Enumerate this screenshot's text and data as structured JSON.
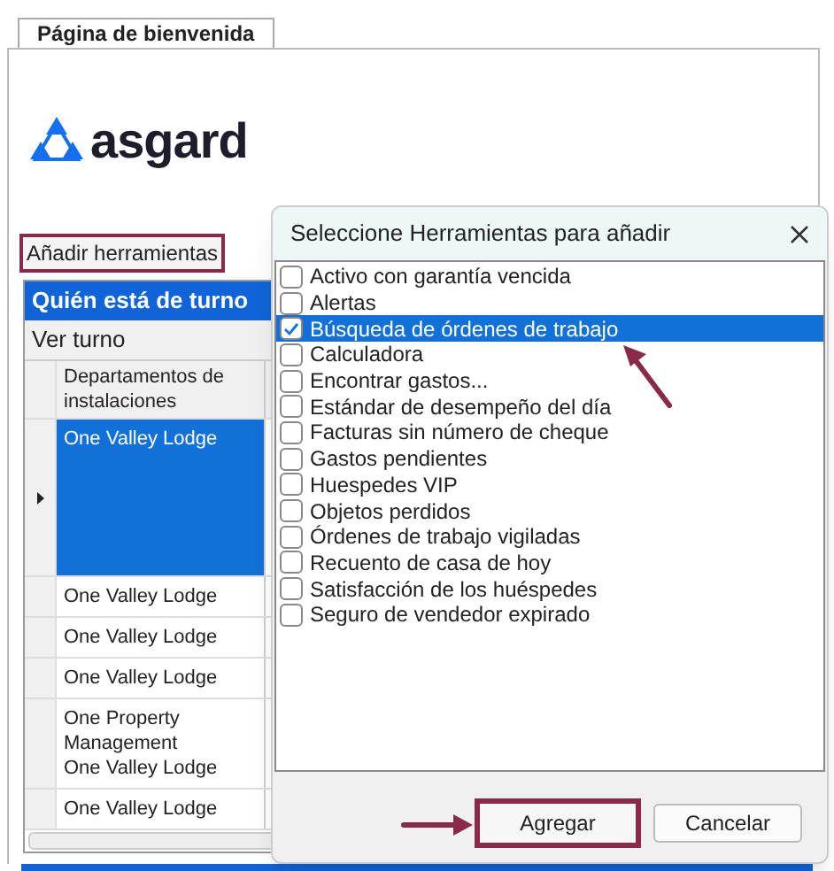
{
  "tab": {
    "label": "Página de bienvenida",
    "selected": true
  },
  "logo": {
    "text": "asgard"
  },
  "add_tools": {
    "label": "Añadir herramientas",
    "highlighted": true
  },
  "shift_panel": {
    "title": "Quién está de turno",
    "view_label": "Ver turno",
    "column_1": "Departamentos de instalaciones",
    "rows": [
      {
        "lines": [
          "One Valley Lodge"
        ],
        "selected": true
      },
      {
        "lines": [
          "One Valley Lodge"
        ],
        "selected": false
      },
      {
        "lines": [
          "One Valley Lodge"
        ],
        "selected": false
      },
      {
        "lines": [
          "One Valley Lodge"
        ],
        "selected": false
      },
      {
        "lines": [
          "One Property",
          "Management",
          "One Valley Lodge"
        ],
        "selected": false
      },
      {
        "lines": [
          "One Valley Lodge"
        ],
        "selected": false
      }
    ]
  },
  "dialog": {
    "title": "Seleccione Herramientas para añadir",
    "items": [
      {
        "label": "Activo con garantía vencida",
        "checked": false,
        "selected": false
      },
      {
        "label": "Alertas",
        "checked": false,
        "selected": false
      },
      {
        "label": "Búsqueda de órdenes de trabajo",
        "checked": true,
        "selected": true
      },
      {
        "label": "Calculadora",
        "checked": false,
        "selected": false
      },
      {
        "label": "Encontrar gastos...",
        "checked": false,
        "selected": false
      },
      {
        "label": "Estándar de desempeño del día",
        "checked": false,
        "selected": false
      },
      {
        "label": "Facturas sin número de cheque",
        "checked": false,
        "selected": false
      },
      {
        "label": "Gastos pendientes",
        "checked": false,
        "selected": false
      },
      {
        "label": "Huespedes VIP",
        "checked": false,
        "selected": false
      },
      {
        "label": "Objetos perdidos",
        "checked": false,
        "selected": false
      },
      {
        "label": "Órdenes de trabajo vigiladas",
        "checked": false,
        "selected": false
      },
      {
        "label": "Recuento de casa de  hoy",
        "checked": false,
        "selected": false
      },
      {
        "label": "Satisfacción de los huéspedes",
        "checked": false,
        "selected": false
      },
      {
        "label": "Seguro de vendedor expirado",
        "checked": false,
        "selected": false
      }
    ],
    "buttons": [
      {
        "label": "Agregar",
        "highlighted": true
      },
      {
        "label": "Cancelar",
        "highlighted": false
      }
    ]
  }
}
